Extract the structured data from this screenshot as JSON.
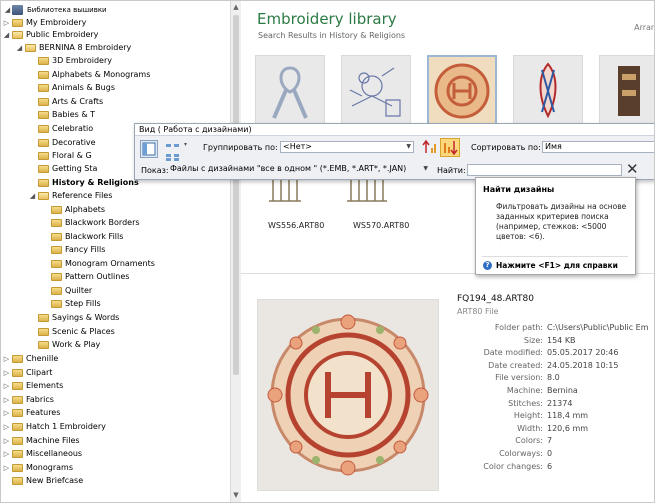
{
  "tree": {
    "root": "Библиотека вышивки",
    "items": [
      {
        "label": "My Embroidery"
      },
      {
        "label": "Public Embroidery"
      },
      {
        "label": "BERNINA 8 Embroidery"
      },
      {
        "label": "3D Embroidery"
      },
      {
        "label": "Alphabets & Monograms"
      },
      {
        "label": "Animals & Bugs"
      },
      {
        "label": "Arts & Crafts"
      },
      {
        "label": "Babies & T"
      },
      {
        "label": "Celebratio"
      },
      {
        "label": "Decorative"
      },
      {
        "label": "Floral & G"
      },
      {
        "label": "Getting Sta"
      },
      {
        "label": "History & Religions"
      },
      {
        "label": "Reference Files"
      },
      {
        "label": "Alphabets"
      },
      {
        "label": "Blackwork Borders"
      },
      {
        "label": "Blackwork Fills"
      },
      {
        "label": "Fancy Fills"
      },
      {
        "label": "Monogram Ornaments"
      },
      {
        "label": "Pattern Outlines"
      },
      {
        "label": "Quilter"
      },
      {
        "label": "Step Fills"
      },
      {
        "label": "Sayings & Words"
      },
      {
        "label": "Scenic & Places"
      },
      {
        "label": "Work & Play"
      },
      {
        "label": "Chenille"
      },
      {
        "label": "Clipart"
      },
      {
        "label": "Elements"
      },
      {
        "label": "Fabrics"
      },
      {
        "label": "Features"
      },
      {
        "label": "Hatch 1 Embroidery"
      },
      {
        "label": "Machine Files"
      },
      {
        "label": "Miscellaneous"
      },
      {
        "label": "Monograms"
      },
      {
        "label": "New Briefcase"
      }
    ]
  },
  "library": {
    "title": "Embroidery library",
    "subtitle": "Search Results in History & Religions",
    "arrange": "Arran",
    "files": [
      "WS556.ART80",
      "WS570.ART80"
    ]
  },
  "toolbar": {
    "header": "Вид ( Работа с дизайнами)",
    "group_label": "Группировать по:",
    "group_value": "<Нет>",
    "sort_label": "Сортировать по:",
    "sort_value": "Имя",
    "show_label": "Показ:",
    "show_value": "Файлы с дизайнами \"все в одном \" (*.EMB, *.ART*, *.JAN)",
    "find_label": "Найти:",
    "find_value": ""
  },
  "tooltip": {
    "title": "Найти дизайны",
    "body": "Фильтровать дизайны на основе заданных критериев поиска (например, стежков: <5000 цветов: <6).",
    "help": "Нажмите <F1> для справки"
  },
  "details": {
    "file": "FQ194_48.ART80",
    "type": "ART80 File",
    "rows": [
      {
        "label": "Folder path:",
        "value": "C:\\Users\\Public\\Public Em"
      },
      {
        "label": "Size:",
        "value": "154 KB"
      },
      {
        "label": "Date modified:",
        "value": "05.05.2017 20:46"
      },
      {
        "label": "Date created:",
        "value": "24.05.2018 10:15"
      },
      {
        "label": "File version:",
        "value": "8.0"
      },
      {
        "label": "Machine:",
        "value": "Bernina"
      },
      {
        "label": "Stitches:",
        "value": "21374"
      },
      {
        "label": "Height:",
        "value": "118,4 mm"
      },
      {
        "label": "Width:",
        "value": "120,6 mm"
      },
      {
        "label": "Colors:",
        "value": "7"
      },
      {
        "label": "Colorways:",
        "value": "0"
      },
      {
        "label": "Color changes:",
        "value": "6"
      }
    ]
  },
  "icons": {
    "folder": "folder-icon",
    "tree_expand": "expand-arrow-icon",
    "close": "close-icon",
    "help": "help-icon"
  },
  "colors": {
    "title_green": "#2c7a43",
    "folder_yellow": "#e8c060",
    "toolbar_bg": "#eef0f4"
  }
}
